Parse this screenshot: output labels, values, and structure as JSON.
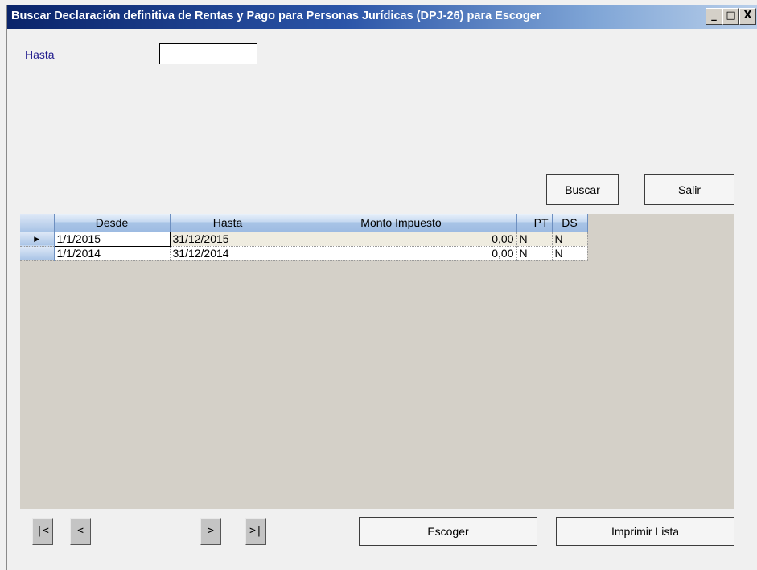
{
  "window": {
    "title": "Buscar Declaración definitiva de Rentas y Pago para Personas Jurídicas (DPJ-26) para Escoger",
    "minimize_glyph": "_",
    "maximize_glyph": "□",
    "close_glyph": "X"
  },
  "filter": {
    "hasta_label": "Hasta",
    "hasta_value": ""
  },
  "buttons": {
    "buscar": "Buscar",
    "salir": "Salir",
    "escoger": "Escoger",
    "imprimir": "Imprimir Lista"
  },
  "grid": {
    "columns": [
      "Desde",
      "Hasta",
      "Monto Impuesto",
      "PT",
      "DS"
    ],
    "current_row_marker": "▶",
    "rows": [
      {
        "desde": "1/1/2015",
        "hasta": "31/12/2015",
        "monto": "0,00",
        "pt": "N",
        "ds": "N"
      },
      {
        "desde": "1/1/2014",
        "hasta": "31/12/2014",
        "monto": "0,00",
        "pt": "N",
        "ds": "N"
      }
    ]
  },
  "navigation": {
    "first": "|<",
    "prev": "<",
    "next": ">",
    "last": ">|"
  }
}
